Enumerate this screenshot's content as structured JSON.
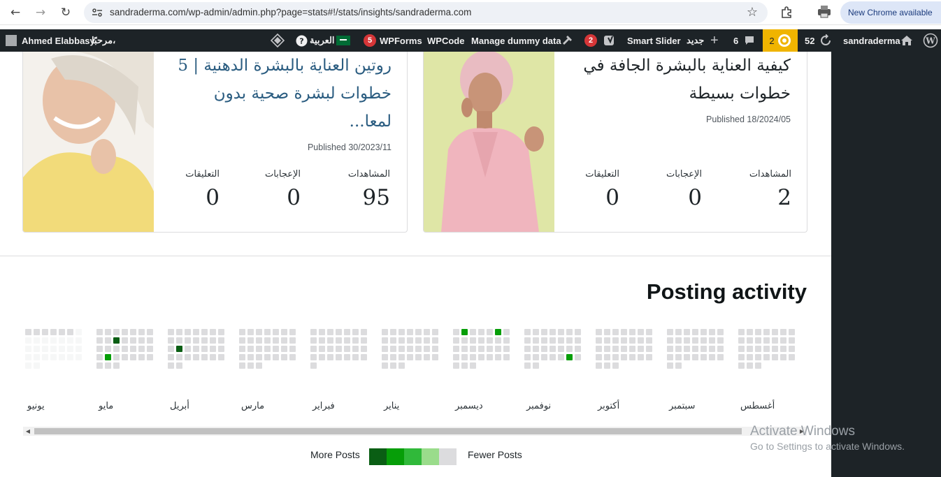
{
  "browser": {
    "url": "sandraderma.com/wp-admin/admin.php?page=stats#!/stats/insights/sandraderma.com",
    "update_label": "New Chrome available"
  },
  "adminbar": {
    "site_name": "sandraderma",
    "updates_count": "52",
    "yellow_count": "2",
    "comments_count": "6",
    "new_label": "جديد",
    "smart_slider": "Smart Slider",
    "yoast_count": "2",
    "manage_dummy": "Manage dummy data",
    "wpcode": "WPCode",
    "wpforms": "WPForms",
    "wpforms_count": "5",
    "language": "العربية",
    "greeting": "مرحبًا،",
    "user_name": "Ahmed Elabbasy"
  },
  "cards": [
    {
      "title": "كيفية العناية بالبشرة الجافة في خطوات بسيطة",
      "date": "2024/05/Published 18",
      "views_label": "المشاهدات",
      "views": "2",
      "likes_label": "الإعجابات",
      "likes": "0",
      "comments_label": "التعليقات",
      "comments": "0"
    },
    {
      "title": "روتين العناية بالبشرة الدهنية | 5 خطوات لبشرة صحية بدون لمعا...",
      "date": "2023/11/Published 30",
      "views_label": "المشاهدات",
      "views": "95",
      "likes_label": "الإعجابات",
      "likes": "0",
      "comments_label": "التعليقات",
      "comments": "0"
    }
  ],
  "posting_activity": {
    "title": "Posting activity",
    "months": [
      "أغسطس",
      "سبتمبر",
      "أكتوبر",
      "نوفمبر",
      "ديسمبر",
      "يناير",
      "فبراير",
      "مارس",
      "أبريل",
      "مايو",
      "يونيو"
    ],
    "legend_more": "More Posts",
    "legend_fewer": "Fewer Posts",
    "colors": {
      "empty": "#dcdcde",
      "future": "#f6f7f7",
      "level1": "#0a5e14",
      "level2": "#069e08",
      "level3": "#30b93a",
      "level4": "#9adc8b"
    }
  },
  "windows": {
    "line1": "Activate Windows",
    "line2": "Go to Settings to activate Windows."
  }
}
